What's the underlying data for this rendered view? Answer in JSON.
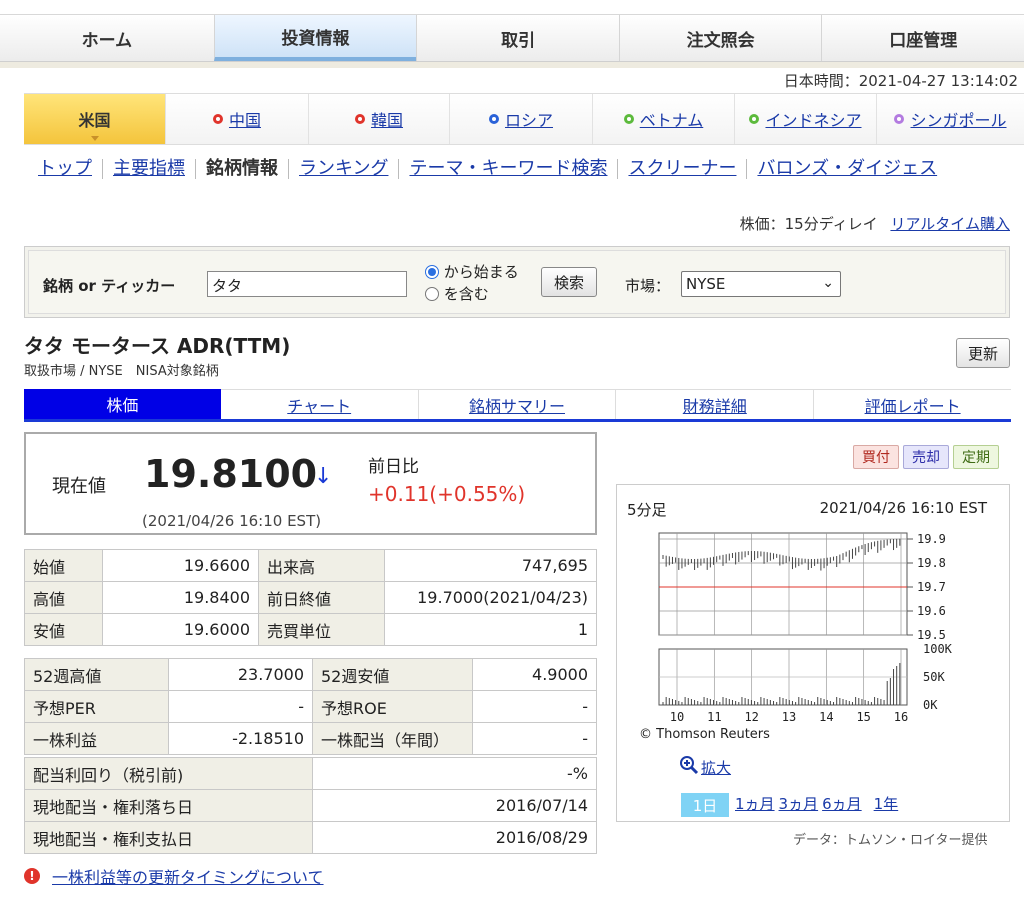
{
  "topnav": [
    "ホーム",
    "投資情報",
    "取引",
    "注文照会",
    "口座管理"
  ],
  "japan_time": "日本時間：2021-04-27 13:14:02",
  "country_tabs": [
    {
      "label": "米国",
      "color": ""
    },
    {
      "label": "中国",
      "color": "#e0342b"
    },
    {
      "label": "韓国",
      "color": "#e0342b"
    },
    {
      "label": "ロシア",
      "color": "#2a62d8"
    },
    {
      "label": "ベトナム",
      "color": "#5cba3c"
    },
    {
      "label": "インドネシア",
      "color": "#5cba3c"
    },
    {
      "label": "シンガポール",
      "color": "#b37be0"
    }
  ],
  "subnav": [
    "トップ",
    "主要指標",
    "銘柄情報",
    "ランキング",
    "テーマ・キーワード検索",
    "スクリーナー",
    "バロンズ・ダイジェス"
  ],
  "delay": {
    "label": "株価：15分ディレイ",
    "link": "リアルタイム購入"
  },
  "search": {
    "label": "銘柄 or ティッカー",
    "value": "タタ",
    "radio1": "から始まる",
    "radio2": "を含む",
    "button": "検索",
    "market_label": "市場：",
    "market_value": "NYSE"
  },
  "stock": {
    "title": "タタ モータース ADR(TTM)",
    "subtitle": "取扱市場 / NYSE　NISA対象銘柄",
    "refresh": "更新"
  },
  "stock_tabs": [
    "株価",
    "チャート",
    "銘柄サマリー",
    "財務詳細",
    "評価レポート"
  ],
  "price": {
    "label": "現在値",
    "value": "19.8100",
    "arrow": "↓",
    "time": "(2021/04/26 16:10 EST)",
    "change_label": "前日比",
    "change": "+0.11",
    "change_pct": "(+0.55%)",
    "pct_paren_close": ")"
  },
  "table1": [
    [
      "始値",
      "19.6600",
      "出来高",
      "747,695"
    ],
    [
      "高値",
      "19.8400",
      "前日終値",
      "19.7000(2021/04/23)"
    ],
    [
      "安値",
      "19.6000",
      "売買単位",
      "1"
    ]
  ],
  "table2": [
    [
      "52週高値",
      "23.7000",
      "52週安値",
      "4.9000"
    ],
    [
      "予想PER",
      "-",
      "予想ROE",
      "-"
    ],
    [
      "一株利益",
      "-2.18510",
      "一株配当（年間）",
      "-"
    ]
  ],
  "table3": [
    [
      "配当利回り（税引前)",
      "-%"
    ],
    [
      "現地配当・権利落ち日",
      "2016/07/14"
    ],
    [
      "現地配当・権利支払日",
      "2016/08/29"
    ]
  ],
  "actions": [
    "買付",
    "売却",
    "定期"
  ],
  "chart": {
    "period_label": "5分足",
    "timestamp": "2021/04/26 16:10 EST",
    "price_ticks": [
      "19.9",
      "19.8",
      "19.7",
      "19.6",
      "19.5"
    ],
    "volume_ticks": [
      "100K",
      "50K",
      "0K"
    ],
    "x_ticks": [
      "10",
      "11",
      "12",
      "13",
      "14",
      "15",
      "16"
    ],
    "source": "© Thomson Reuters",
    "zoom": "拡大",
    "ranges": [
      "1日",
      "1ヵ月",
      "3ヵ月",
      "6ヵ月",
      "1年"
    ]
  },
  "credit": "データ：トムソン・ロイター提供",
  "note": "一株利益等の更新タイミングについて",
  "colors": {
    "accent": "#0000e6",
    "up": "#e0342b",
    "down": "#1a3ad6",
    "tab_active": "#f4c43c"
  }
}
